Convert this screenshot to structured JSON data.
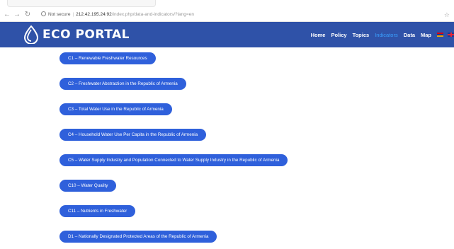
{
  "browser": {
    "security_label": "Not secure",
    "url_host": "212.42.195.24:92",
    "url_path": "/index.php/data-and-indicators/?lang=en"
  },
  "header": {
    "logo_text": "ECO PORTAL",
    "nav": [
      {
        "label": "Home",
        "active": false
      },
      {
        "label": "Policy",
        "active": false
      },
      {
        "label": "Topics",
        "active": false
      },
      {
        "label": "Indicators",
        "active": true
      },
      {
        "label": "Data",
        "active": false
      },
      {
        "label": "Map",
        "active": false
      }
    ],
    "colors": {
      "bar": "#2f52a8",
      "active_link": "#3aa0ff"
    }
  },
  "indicators": [
    {
      "label": "C1 – Renewable Freshwater Resources"
    },
    {
      "label": "C2 – Freshwater Abstraction in the Republic of Armenia"
    },
    {
      "label": "C3 – Total Water Use in the Republic of Armenia"
    },
    {
      "label": "C4 – Household Water Use Per Capita in the Republic of Armenia"
    },
    {
      "label": "C5 – Water Supply Industry and Population Connected to Water Supply Industry in the Republic of Armenia"
    },
    {
      "label": "C10 – Water Quality"
    },
    {
      "label": "C11 – Nutrients in Freshwater"
    },
    {
      "label": "D1 – Nationally Designated Protected Areas of the Republic of Armenia"
    }
  ],
  "pill_color": "#2f60db"
}
